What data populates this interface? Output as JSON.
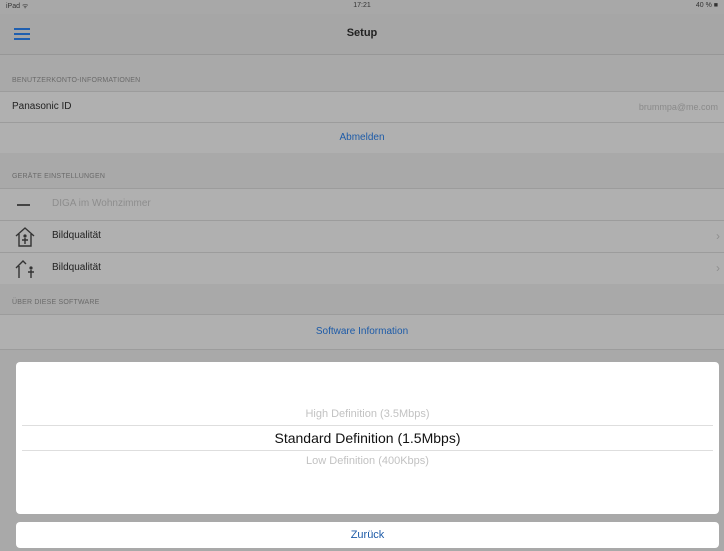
{
  "statusbar": {
    "carrier": "iPad ᯤ",
    "time": "17:21",
    "battery": "40 % ■"
  },
  "navbar": {
    "title": "Setup"
  },
  "sections": {
    "account": {
      "header": "BENUTZERKONTO-INFORMATIONEN",
      "id_label": "Panasonic ID",
      "id_value": "brummpa@me.com",
      "logout_label": "Abmelden"
    },
    "device": {
      "header": "GERÄTE EINSTELLUNGEN",
      "device_name": "DIGA im Wohnzimmer",
      "rows": [
        {
          "label": "Bildqualität",
          "icon": "home-icon"
        },
        {
          "label": "Bildqualität",
          "icon": "away-icon"
        }
      ]
    },
    "about": {
      "header": "ÜBER DIESE SOFTWARE",
      "link_label": "Software Information"
    }
  },
  "picker": {
    "options": [
      "High Definition (3.5Mbps)",
      "Standard Definition (1.5Mbps)",
      "Low Definition (400Kbps)"
    ],
    "selected": "Standard Definition (1.5Mbps)"
  },
  "cancel_label": "Zurück",
  "colors": {
    "accent": "#1d5ba8",
    "dim_background": "#a9a9a9"
  }
}
